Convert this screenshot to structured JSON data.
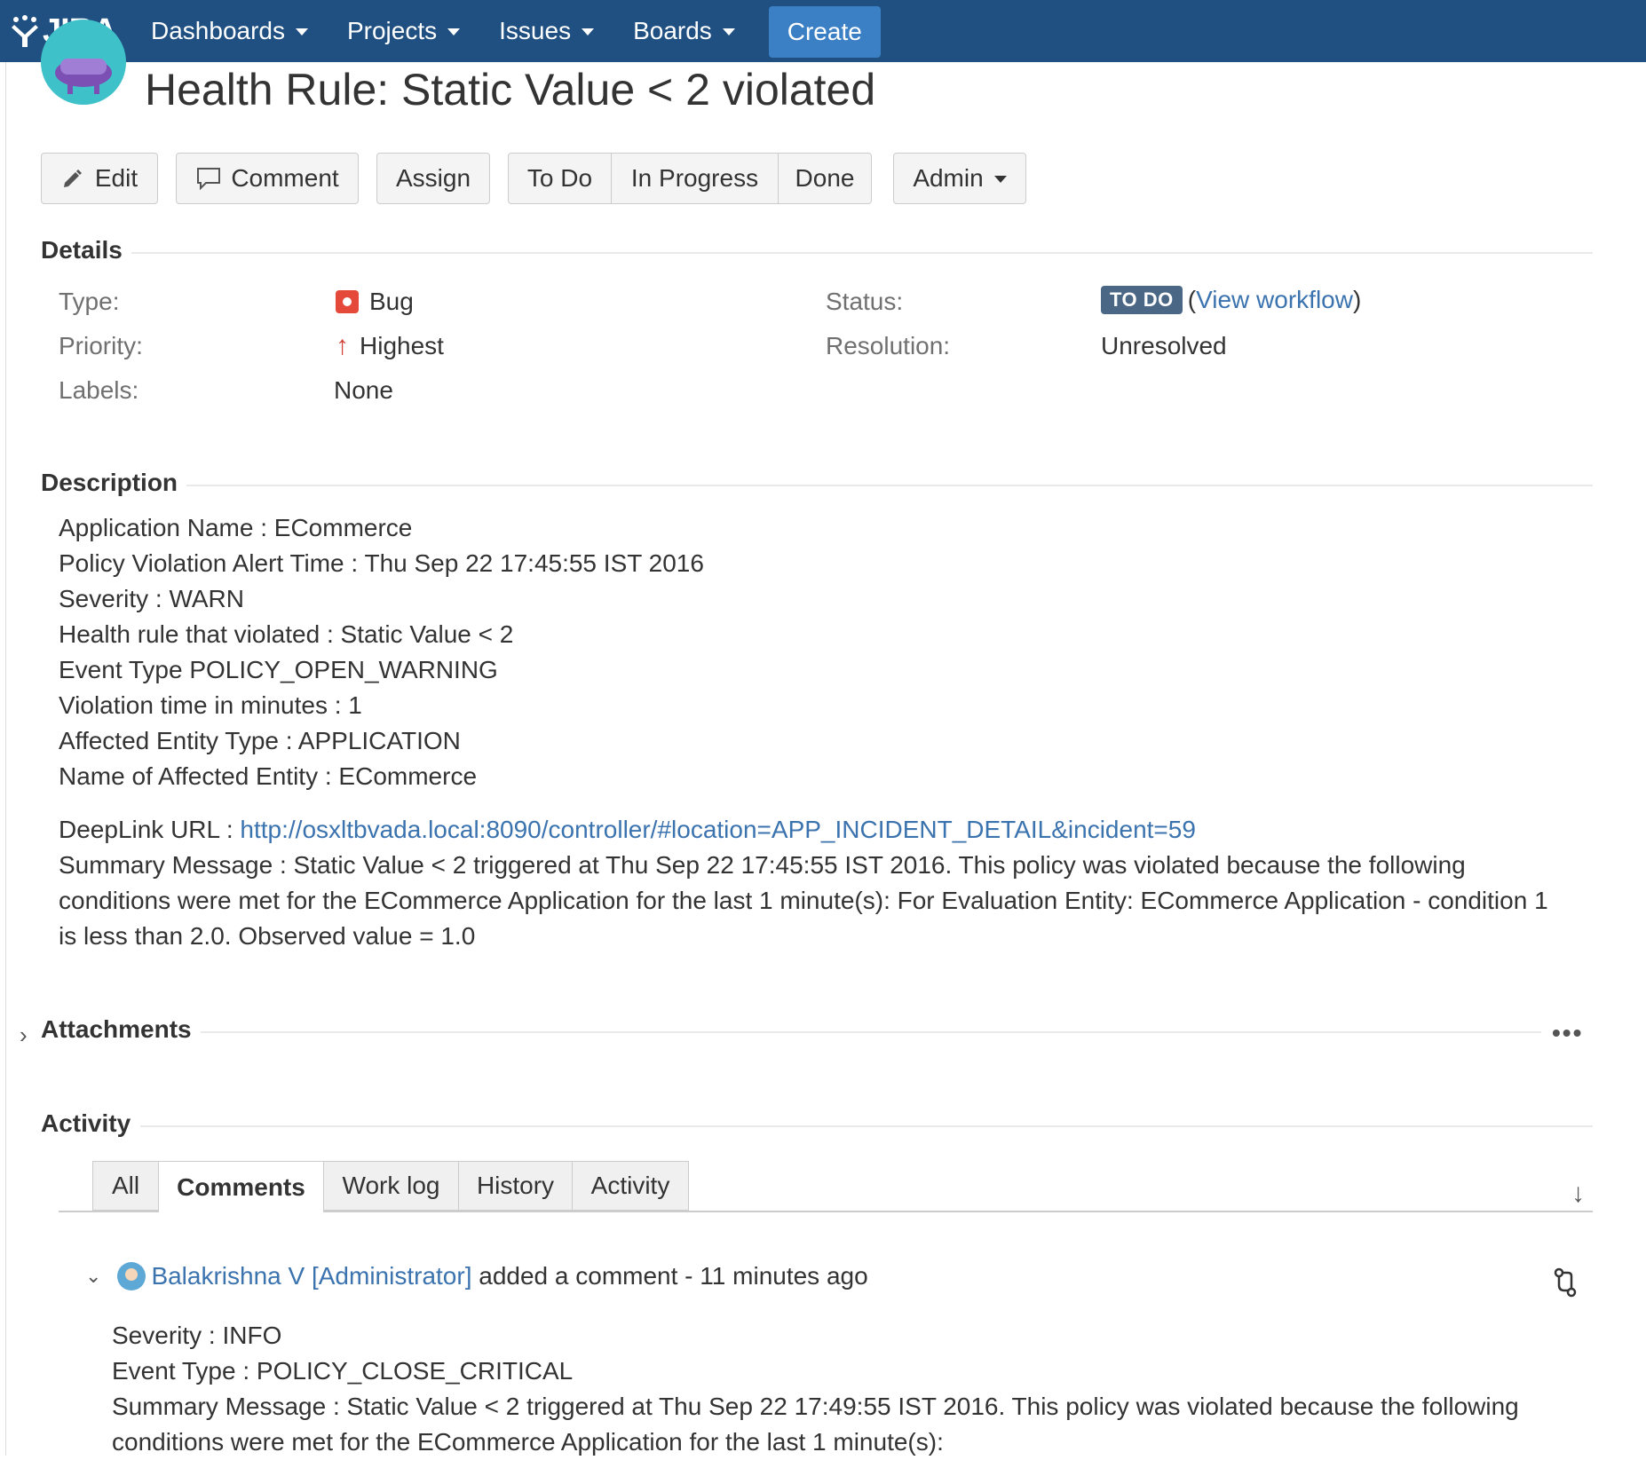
{
  "nav": {
    "logo_text": "JIRA",
    "items": [
      {
        "label": "Dashboards"
      },
      {
        "label": "Projects"
      },
      {
        "label": "Issues"
      },
      {
        "label": "Boards"
      }
    ],
    "create_label": "Create"
  },
  "issue": {
    "title": "Health Rule: Static Value < 2 violated"
  },
  "toolbar": {
    "edit": "Edit",
    "comment": "Comment",
    "assign": "Assign",
    "workflow": [
      "To Do",
      "In Progress",
      "Done"
    ],
    "admin": "Admin"
  },
  "details": {
    "heading": "Details",
    "type_label": "Type:",
    "type_value": "Bug",
    "priority_label": "Priority:",
    "priority_value": "Highest",
    "labels_label": "Labels:",
    "labels_value": "None",
    "status_label": "Status:",
    "status_value": "TO DO",
    "status_paren_open": "(",
    "view_workflow": "View workflow",
    "status_paren_close": ")",
    "resolution_label": "Resolution:",
    "resolution_value": "Unresolved",
    "colors": {
      "bug": "#e5493a",
      "priority": "#d04437",
      "status_lozenge": "#4a6785"
    }
  },
  "description": {
    "heading": "Description",
    "lines": [
      "Application Name : ECommerce",
      "Policy Violation Alert Time : Thu Sep 22 17:45:55 IST 2016",
      "Severity : WARN",
      "Health rule that violated : Static Value < 2",
      "Event Type POLICY_OPEN_WARNING",
      "Violation time in minutes : 1",
      "Affected Entity Type : APPLICATION",
      "Name of Affected Entity : ECommerce"
    ],
    "deeplink_label": "DeepLink URL : ",
    "deeplink_url": "http://osxltbvada.local:8090/controller/#location=APP_INCIDENT_DETAIL&incident=59",
    "summary": "Summary Message : Static Value < 2 triggered at Thu Sep 22 17:45:55 IST 2016. This policy was violated because the following conditions were met for the ECommerce Application for the last 1 minute(s): For Evaluation Entity: ECommerce Application - condition 1 is less than 2.0. Observed value = 1.0"
  },
  "attachments": {
    "heading": "Attachments",
    "more": "•••"
  },
  "activity": {
    "heading": "Activity",
    "tabs": [
      "All",
      "Comments",
      "Work log",
      "History",
      "Activity"
    ],
    "active_tab": "Comments",
    "comment": {
      "author": "Balakrishna V [Administrator]",
      "action": " added a comment - ",
      "time": "11 minutes ago",
      "lines": [
        "Severity : INFO",
        "Event Type : POLICY_CLOSE_CRITICAL"
      ],
      "summary": "Summary Message : Static Value < 2 triggered at Thu Sep 22 17:49:55 IST 2016. This policy was violated because the following conditions were met for the ECommerce Application for the last 1 minute(s):"
    }
  },
  "colors": {
    "topbar": "#205081",
    "create": "#3b7fc4",
    "link": "#3b73af"
  }
}
